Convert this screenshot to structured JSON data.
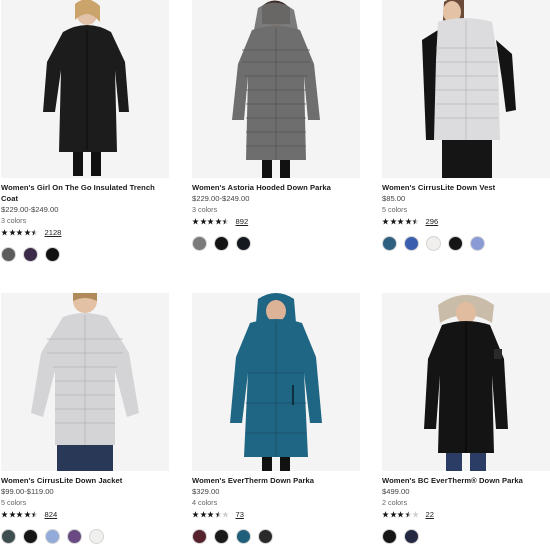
{
  "products": [
    {
      "name": "Women's Girl On The Go Insulated Trench Coat",
      "price": "$229.00-$249.00",
      "colors_text": "3 colors",
      "rating": 4.5,
      "reviews": "2128",
      "swatches": [
        "#5c5c5c",
        "#3b2b48",
        "#111111"
      ],
      "jacket_color": "#1c1c1c"
    },
    {
      "name": "Women's Astoria Hooded Down Parka",
      "price": "$229.00-$249.00",
      "colors_text": "3 colors",
      "rating": 4.5,
      "reviews": "892",
      "swatches": [
        "#7a7a7a",
        "#141414",
        "#16181f"
      ],
      "jacket_color": "#6e6e6e"
    },
    {
      "name": "Women's CirrusLite Down Vest",
      "price": "$85.00",
      "colors_text": "5 colors",
      "rating": 4.5,
      "reviews": "296",
      "swatches": [
        "#2f5f7e",
        "#3a5dae",
        "#f0efee",
        "#151515",
        "#8a9bd6"
      ],
      "jacket_color": "#dcdcde"
    },
    {
      "name": "Women's CirrusLite Down Jacket",
      "price": "$99.00-$119.00",
      "colors_text": "5 colors",
      "rating": 4.5,
      "reviews": "824",
      "swatches": [
        "#3e4d4d",
        "#161616",
        "#93abd8",
        "#6a4a82",
        "#f0f0ef"
      ],
      "jacket_color": "#d4d4d6"
    },
    {
      "name": "Women's EverTherm Down Parka",
      "price": "$329.00",
      "colors_text": "4 colors",
      "rating": 3.5,
      "reviews": "73",
      "swatches": [
        "#55222e",
        "#1a1a1a",
        "#1f5f7c",
        "#2a2a2a"
      ],
      "jacket_color": "#1f6684"
    },
    {
      "name": "Women's BC EverTherm® Down Parka",
      "price": "$499.00",
      "colors_text": "2 colors",
      "rating": 3.5,
      "reviews": "22",
      "swatches": [
        "#161616",
        "#242840"
      ],
      "jacket_color": "#141414"
    }
  ]
}
